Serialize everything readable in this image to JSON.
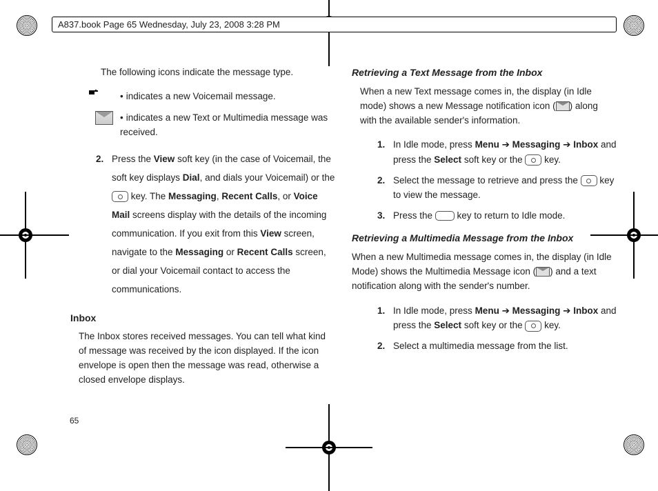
{
  "header": "A837.book  Page 65  Wednesday, July 23, 2008  3:28 PM",
  "page_number": "65",
  "left": {
    "intro": "The following icons indicate the message type.",
    "icon_rows": [
      {
        "text": "indicates a new Voicemail message."
      },
      {
        "text": "indicates a new Text or Multimedia message was received."
      }
    ],
    "step2": {
      "pre": "Press the ",
      "b1": "View",
      "t1": " soft key (in the case of Voicemail, the soft key displays ",
      "b2": "Dial",
      "t2": ", and dials your Voicemail) or the ",
      "t3": " key. The ",
      "b3": "Messaging",
      "t4": ", ",
      "b4": "Recent Calls",
      "t5": ", or ",
      "b5": "Voice Mail",
      "t6": " screens display with the details of the incoming communication. If you exit from this ",
      "b6": "View",
      "t7": " screen, navigate to the ",
      "b7": "Messaging",
      "t8": " or ",
      "b8": "Recent Calls",
      "t9": " screen, or dial your Voicemail contact to access the communications."
    },
    "inbox_heading": "Inbox",
    "inbox_para": "The Inbox stores received messages. You can tell what kind of message was received by the icon displayed. If the icon envelope is open then the message was read, otherwise a closed envelope displays."
  },
  "right": {
    "h1": "Retrieving a Text Message from the Inbox",
    "p1a": "When a new Text message comes in, the display (in Idle mode) shows a new Message notification icon (",
    "p1b": ") along with the available sender's information.",
    "text_steps": {
      "s1": {
        "a": "In Idle mode, press ",
        "b1": "Menu",
        "arrow1": " ➔ ",
        "b2": "Messaging",
        "arrow2": " ➔ ",
        "b3": "Inbox",
        "mid": " and press the ",
        "b4": "Select",
        "tail": " soft key or the ",
        "tail2": " key."
      },
      "s2": {
        "a": "Select the message to retrieve and press the ",
        "mid": " key to view the message."
      },
      "s3": {
        "a": "Press the ",
        "mid": " key to return to Idle mode."
      }
    },
    "h2": "Retrieving a Multimedia Message from the Inbox",
    "p2a": "When a new Multimedia message comes in, the display (in Idle Mode) shows the Multimedia Message icon (",
    "p2b": ") and a text notification along with the sender's number.",
    "mm_steps": {
      "s1": {
        "a": "In Idle mode, press ",
        "b1": "Menu",
        "arrow1": " ➔ ",
        "b2": "Messaging",
        "arrow2": " ➔ ",
        "b3": "Inbox",
        "mid": " and press the ",
        "b4": "Select",
        "tail": " soft key or the ",
        "tail2": " key."
      },
      "s2": {
        "a": "Select a multimedia message from the list."
      }
    }
  }
}
